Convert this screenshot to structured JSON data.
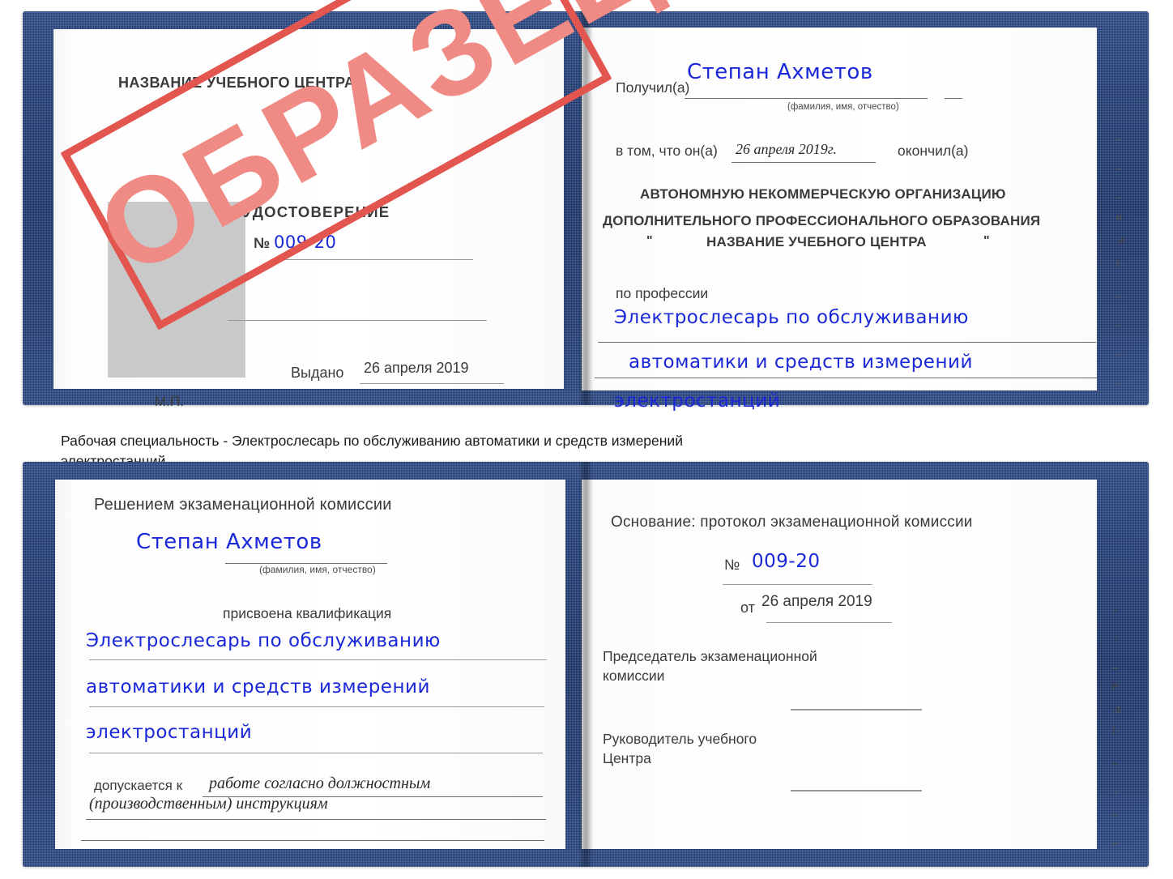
{
  "watermark": {
    "text": "ОБРАЗЕЦ"
  },
  "caption": {
    "line1": "Рабочая специальность - Электрослесарь по обслуживанию автоматики и средств измерений",
    "line2": "электростанций"
  },
  "certificate_top": {
    "left_page": {
      "center_name": "НАЗВАНИЕ УЧЕБНОГО ЦЕНТРА",
      "doc_title": "УДОСТОВЕРЕНИЕ",
      "number_label": "№",
      "number_value": "009-20",
      "issued_label": "Выдано",
      "issued_value": "26 апреля 2019",
      "seal_label": "М.П.",
      "photo_placeholder": "photo-placeholder"
    },
    "right_page": {
      "received_label": "Получил(а)",
      "received_value": "Степан Ахметов",
      "fio_hint": "(фамилия, имя, отчество)",
      "in_that_label": "в том, что он(а)",
      "in_that_value": "26 апреля 2019г.",
      "finished_label": "окончил(а)",
      "org_line1": "АВТОНОМНУЮ НЕКОММЕРЧЕСКУЮ ОРГАНИЗАЦИЮ",
      "org_line2": "ДОПОЛНИТЕЛЬНОГО ПРОФЕССИОНАЛЬНОГО ОБРАЗОВАНИЯ",
      "org_quote_open": "\"",
      "org_line3": "НАЗВАНИЕ УЧЕБНОГО ЦЕНТРА",
      "org_quote_close": "\"",
      "profession_label": "по профессии",
      "profession_line1": "Электрослесарь по обслуживанию",
      "profession_line2": "автоматики и средств измерений",
      "profession_line3": "электростанций",
      "edge_marks": [
        "–",
        "–",
        "–",
        "и",
        ",а",
        "(-",
        "–",
        "–",
        "–",
        "–"
      ]
    }
  },
  "certificate_bottom": {
    "left_page": {
      "heading": "Решением экзаменационной комиссии",
      "name_value": "Степан Ахметов",
      "fio_hint": "(фамилия, имя, отчество)",
      "qualification_label": "присвоена квалификация",
      "qualification_line1": "Электрослесарь по обслуживанию",
      "qualification_line2": "автоматики и средств измерений",
      "qualification_line3": "электростанций",
      "allowed_label": "допускается к",
      "allowed_value_line1": "работе согласно должностным",
      "allowed_value_line2": "(производственным) инструкциям"
    },
    "right_page": {
      "basis_label": "Основание: протокол экзаменационной комиссии",
      "number_label": "№",
      "number_value": "009-20",
      "date_label": "от",
      "date_value": "26 апреля 2019",
      "chairman_line1": "Председатель экзаменационной",
      "chairman_line2": "комиссии",
      "head_line1": "Руководитель учебного",
      "head_line2": "Центра",
      "edge_marks": [
        "–",
        "–",
        "–",
        "и",
        ",а",
        "(-",
        "–",
        "–",
        "–",
        "–"
      ]
    }
  },
  "colors": {
    "cover_blue": "#21407e",
    "stamp_red": "#e2564f",
    "stamp_fill": "#ef8a84",
    "ink_blue": "#1b28d8",
    "photo_gray": "#c9c9c9"
  }
}
